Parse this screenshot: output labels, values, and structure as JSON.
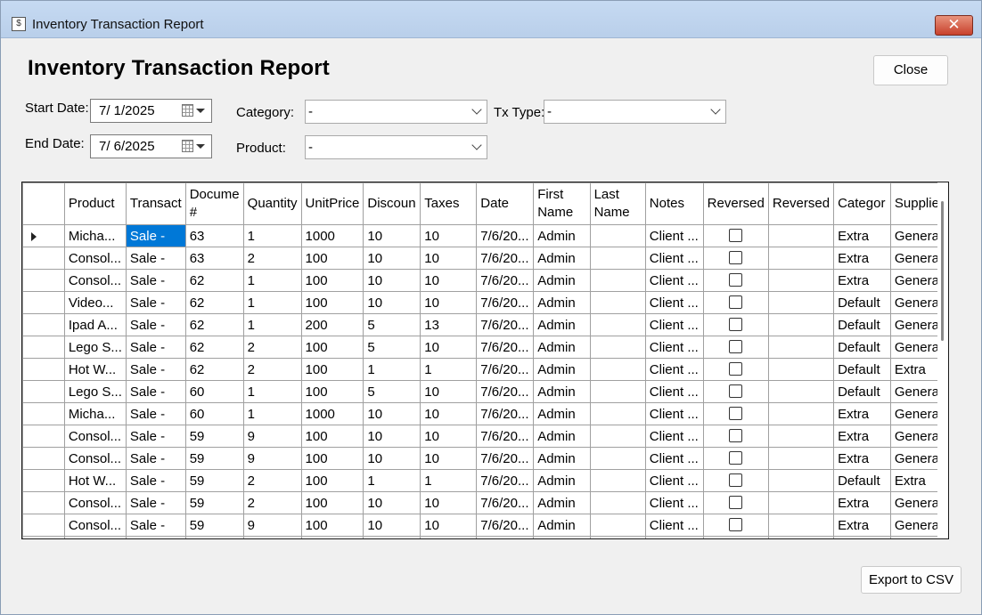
{
  "window": {
    "title": "Inventory Transaction Report",
    "app_icon_glyph": "$",
    "close_glyph": "✕"
  },
  "heading": "Inventory Transaction Report",
  "buttons": {
    "close": "Close",
    "export": "Export to CSV"
  },
  "filters": {
    "start_date_label": "Start Date:",
    "start_date": "7/  1/2025",
    "end_date_label": "End Date:",
    "end_date": "7/  6/2025",
    "category_label": "Category:",
    "category": "-",
    "product_label": "Product:",
    "product": "-",
    "txtype_label": "Tx Type:",
    "txtype": "-"
  },
  "grid": {
    "columns": [
      "Product",
      "Transact",
      "Docume #",
      "Quantity",
      "UnitPrice",
      "Discoun",
      "Taxes",
      "Date",
      "First Name",
      "Last Name",
      "Notes",
      "Reversed",
      "Reversed",
      "Categor",
      "Supplier"
    ],
    "rows": [
      [
        "Micha...",
        "Sale -",
        "63",
        "1",
        "1000",
        "10",
        "10",
        "7/6/20...",
        "Admin",
        "",
        "Client ...",
        false,
        "",
        "Extra",
        "General"
      ],
      [
        "Consol...",
        "Sale -",
        "63",
        "2",
        "100",
        "10",
        "10",
        "7/6/20...",
        "Admin",
        "",
        "Client ...",
        false,
        "",
        "Extra",
        "General"
      ],
      [
        "Consol...",
        "Sale -",
        "62",
        "1",
        "100",
        "10",
        "10",
        "7/6/20...",
        "Admin",
        "",
        "Client ...",
        false,
        "",
        "Extra",
        "General"
      ],
      [
        "Video...",
        "Sale -",
        "62",
        "1",
        "100",
        "10",
        "10",
        "7/6/20...",
        "Admin",
        "",
        "Client ...",
        false,
        "",
        "Default",
        "General"
      ],
      [
        "Ipad A...",
        "Sale -",
        "62",
        "1",
        "200",
        "5",
        "13",
        "7/6/20...",
        "Admin",
        "",
        "Client ...",
        false,
        "",
        "Default",
        "General"
      ],
      [
        "Lego S...",
        "Sale -",
        "62",
        "2",
        "100",
        "5",
        "10",
        "7/6/20...",
        "Admin",
        "",
        "Client ...",
        false,
        "",
        "Default",
        "General"
      ],
      [
        "Hot W...",
        "Sale -",
        "62",
        "2",
        "100",
        "1",
        "1",
        "7/6/20...",
        "Admin",
        "",
        "Client ...",
        false,
        "",
        "Default",
        "Extra"
      ],
      [
        "Lego S...",
        "Sale -",
        "60",
        "1",
        "100",
        "5",
        "10",
        "7/6/20...",
        "Admin",
        "",
        "Client ...",
        false,
        "",
        "Default",
        "General"
      ],
      [
        "Micha...",
        "Sale -",
        "60",
        "1",
        "1000",
        "10",
        "10",
        "7/6/20...",
        "Admin",
        "",
        "Client ...",
        false,
        "",
        "Extra",
        "General"
      ],
      [
        "Consol...",
        "Sale -",
        "59",
        "9",
        "100",
        "10",
        "10",
        "7/6/20...",
        "Admin",
        "",
        "Client ...",
        false,
        "",
        "Extra",
        "General"
      ],
      [
        "Consol...",
        "Sale -",
        "59",
        "9",
        "100",
        "10",
        "10",
        "7/6/20...",
        "Admin",
        "",
        "Client ...",
        false,
        "",
        "Extra",
        "General"
      ],
      [
        "Hot W...",
        "Sale -",
        "59",
        "2",
        "100",
        "1",
        "1",
        "7/6/20...",
        "Admin",
        "",
        "Client ...",
        false,
        "",
        "Default",
        "Extra"
      ],
      [
        "Consol...",
        "Sale -",
        "59",
        "2",
        "100",
        "10",
        "10",
        "7/6/20...",
        "Admin",
        "",
        "Client ...",
        false,
        "",
        "Extra",
        "General"
      ],
      [
        "Consol...",
        "Sale -",
        "59",
        "9",
        "100",
        "10",
        "10",
        "7/6/20...",
        "Admin",
        "",
        "Client ...",
        false,
        "",
        "Extra",
        "General"
      ],
      [
        "",
        "",
        "",
        "",
        "",
        "",
        "",
        "",
        "",
        "",
        "",
        false,
        "",
        "",
        ""
      ]
    ],
    "current_row": 0,
    "selected_cell": {
      "row": 0,
      "col": 1
    }
  },
  "colors": {
    "selection": "#0078d7",
    "titlebar": "#c6daf2",
    "close_button": "#c8412c"
  }
}
